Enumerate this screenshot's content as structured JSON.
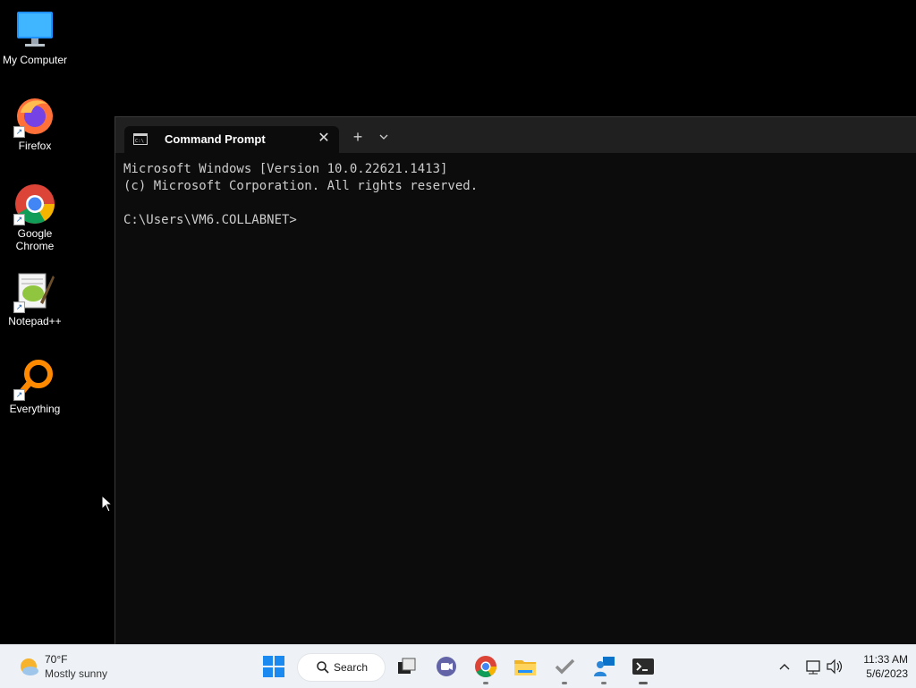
{
  "desktop": {
    "icons": [
      {
        "label": "My Computer",
        "icon": "monitor-icon"
      },
      {
        "label": "Firefox",
        "icon": "firefox-icon"
      },
      {
        "label": "Google\nChrome",
        "icon": "chrome-icon"
      },
      {
        "label": "Notepad++",
        "icon": "notepadpp-icon"
      },
      {
        "label": "Everything",
        "icon": "everything-icon"
      }
    ]
  },
  "terminal": {
    "tab_title": "Command Prompt",
    "close_glyph": "✕",
    "add_glyph": "+",
    "output_lines": [
      "Microsoft Windows [Version 10.0.22621.1413]",
      "(c) Microsoft Corporation. All rights reserved.",
      "",
      "C:\\Users\\VM6.COLLABNET>"
    ]
  },
  "taskbar": {
    "weather": {
      "temp": "70°F",
      "condition": "Mostly sunny"
    },
    "search_label": "Search",
    "apps": [
      "start-icon",
      "task-view-icon",
      "teams-chat-icon",
      "chrome-icon",
      "file-explorer-icon",
      "checkmark-app-icon",
      "remote-desktop-icon",
      "terminal-icon"
    ],
    "clock": {
      "time": "11:33 AM",
      "date": "5/6/2023"
    }
  },
  "colors": {
    "desktop_bg": "#000000",
    "terminal_bg": "#0c0c0c",
    "tabbar_bg": "#202020",
    "taskbar_bg": "#eef2f6",
    "console_text": "#cccccc"
  }
}
